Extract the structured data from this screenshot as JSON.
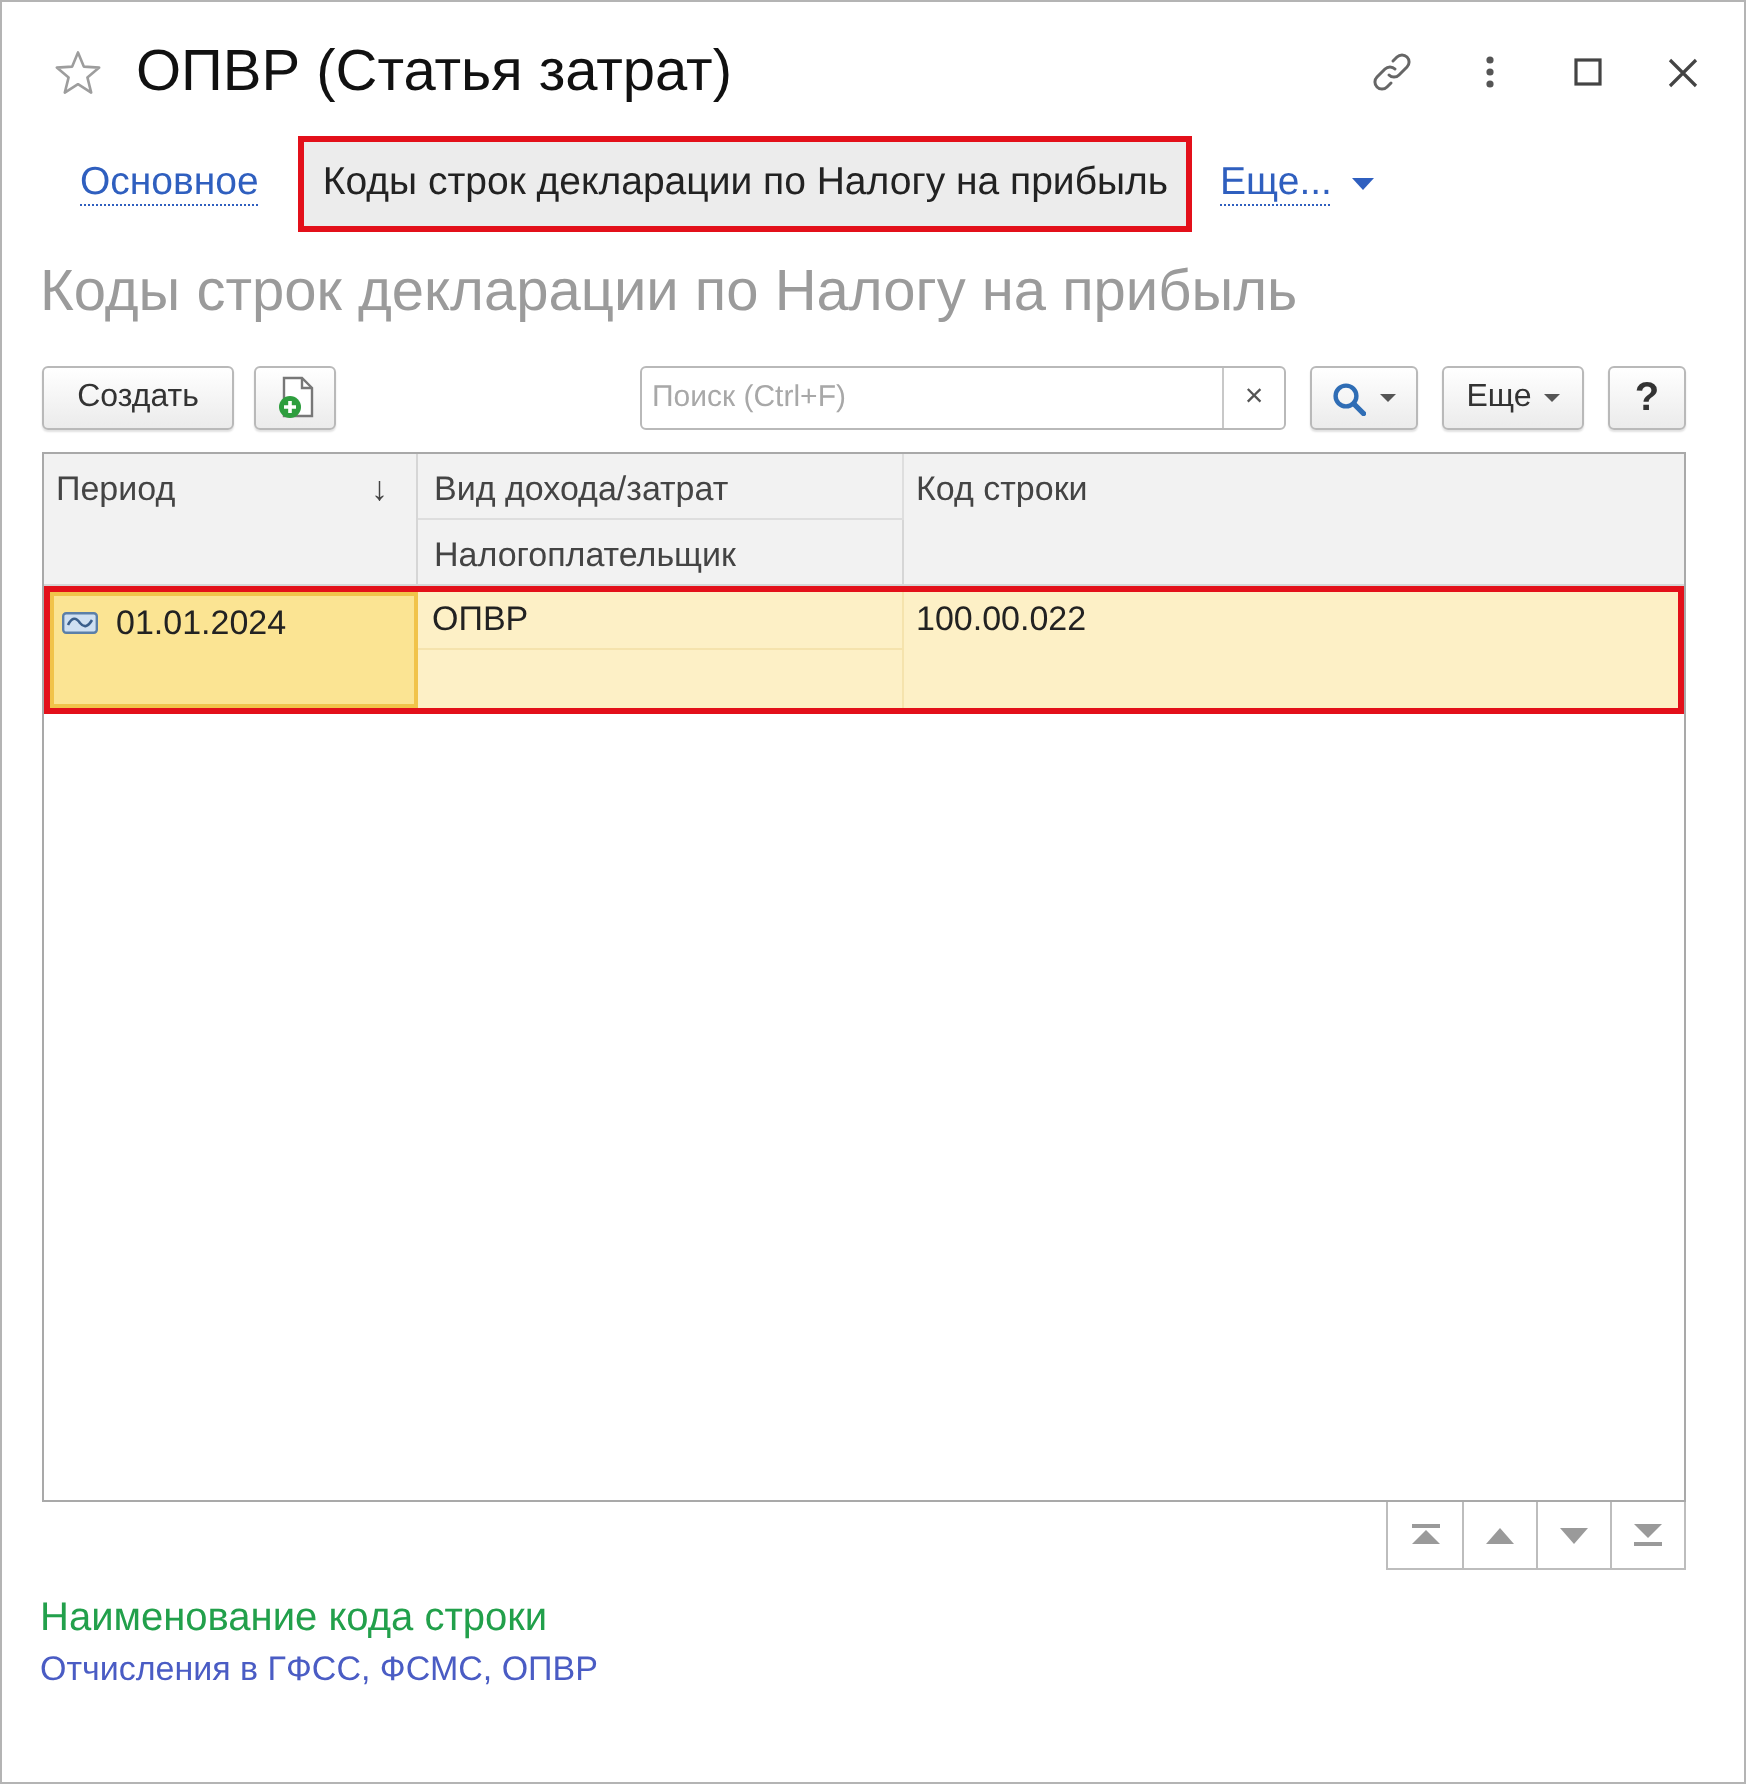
{
  "window": {
    "title": "ОПВР (Статья затрат)",
    "favorite": false
  },
  "tabs": [
    {
      "label": "Основное",
      "selected": false,
      "highlighted": false
    },
    {
      "label": "Коды строк декларации по Налогу на прибыль",
      "selected": true,
      "highlighted": true
    }
  ],
  "more_menu": {
    "label": "Еще..."
  },
  "section_title": "Коды строк декларации по Налогу на прибыль",
  "toolbar": {
    "create_button": "Создать",
    "search": {
      "placeholder": "Поиск (Ctrl+F)",
      "clear_button": "×"
    },
    "more_button": "Еще",
    "help_button": "?"
  },
  "table": {
    "columns": [
      {
        "label": "Период",
        "sort_indicator": "↓"
      },
      {
        "label": "Вид дохода/затрат",
        "sublabel": "Налогоплательщик"
      },
      {
        "label": "Код строки"
      }
    ],
    "rows": [
      {
        "period": "01.01.2024",
        "income_type": "ОПВР",
        "line_code": "100.00.022",
        "selected": true,
        "highlighted": true
      }
    ]
  },
  "details": {
    "label": "Наименование кода строки",
    "value": "Отчисления в ГФСС, ФСМС, ОПВР"
  }
}
